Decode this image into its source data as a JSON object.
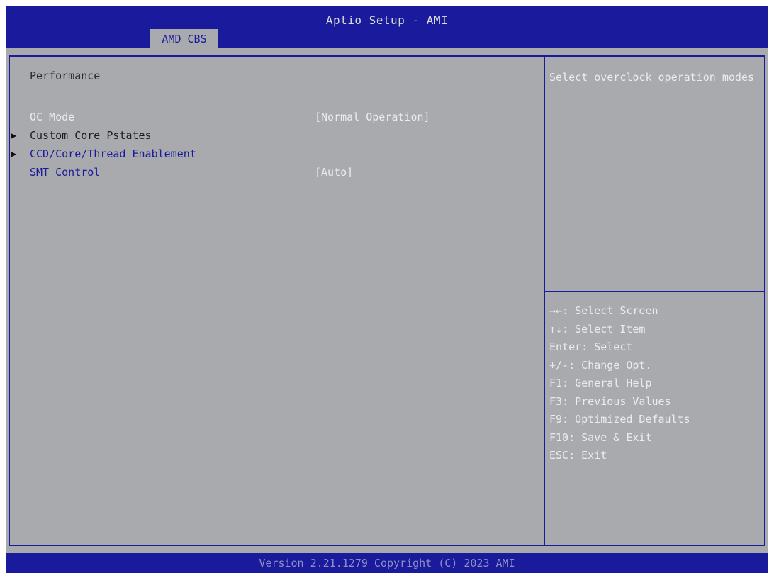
{
  "header": {
    "title": "Aptio Setup - AMI",
    "active_tab": "AMD CBS"
  },
  "main": {
    "section_title": "Performance",
    "items": [
      {
        "label": "OC Mode",
        "value": "[Normal Operation]",
        "submenu": false,
        "selected": true
      },
      {
        "label": "Custom Core Pstates",
        "value": "",
        "submenu": true,
        "selected": false
      },
      {
        "label": "CCD/Core/Thread Enablement",
        "value": "",
        "submenu": true,
        "selected": false
      },
      {
        "label": "SMT Control",
        "value": "[Auto]",
        "submenu": false,
        "selected": false
      }
    ]
  },
  "help": {
    "text": "Select overclock operation modes"
  },
  "keys": [
    {
      "key": "→←",
      "action": "Select Screen"
    },
    {
      "key": "↑↓",
      "action": "Select Item"
    },
    {
      "key": "Enter",
      "action": "Select"
    },
    {
      "key": "+/-",
      "action": "Change Opt."
    },
    {
      "key": "F1",
      "action": "General Help"
    },
    {
      "key": "F3",
      "action": "Previous Values"
    },
    {
      "key": "F9",
      "action": "Optimized Defaults"
    },
    {
      "key": "F10",
      "action": "Save & Exit"
    },
    {
      "key": "ESC",
      "action": "Exit"
    }
  ],
  "footer": {
    "version": "Version 2.21.1279 Copyright (C) 2023 AMI"
  },
  "colors": {
    "bar_blue": "#1a1a9c",
    "panel_gray": "#a9aaad",
    "text_white": "#ececec"
  },
  "icons": {
    "submenu": "triangle-right-icon"
  }
}
